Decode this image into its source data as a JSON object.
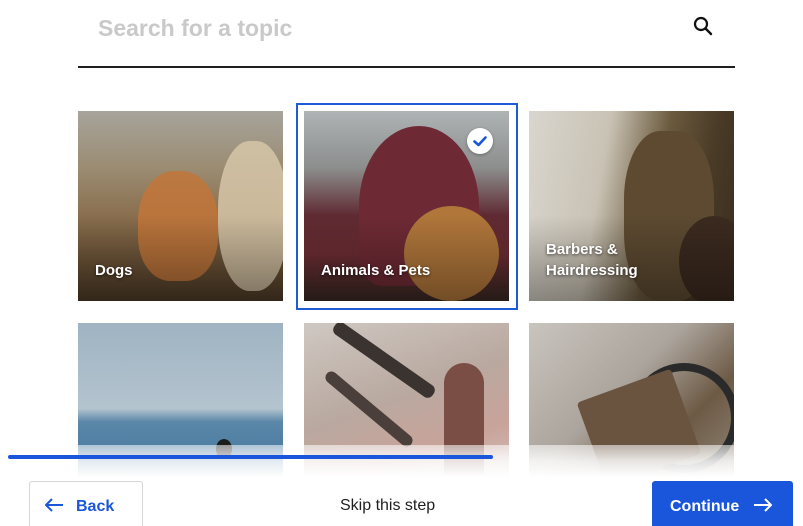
{
  "search": {
    "placeholder": "Search for a topic",
    "value": "",
    "icon": "search-icon"
  },
  "topics": [
    {
      "label": "Dogs",
      "selected": false,
      "image": "dogs-photo"
    },
    {
      "label": "Animals & Pets",
      "selected": true,
      "image": "animals-pets-photo"
    },
    {
      "label": "Barbers &\nHairdressing",
      "selected": false,
      "image": "barbers-photo"
    },
    {
      "label": "",
      "selected": false,
      "image": "sea-photo"
    },
    {
      "label": "",
      "selected": false,
      "image": "makeup-brushes-photo"
    },
    {
      "label": "",
      "selected": false,
      "image": "stethoscope-photo"
    }
  ],
  "progress": {
    "fraction": 0.61
  },
  "footer": {
    "back_label": "Back",
    "skip_label": "Skip this step",
    "continue_label": "Continue"
  },
  "colors": {
    "accent": "#1a56db",
    "selected_border": "#1e5bd6",
    "text": "#1f1f1f",
    "placeholder": "#c9c9c9"
  }
}
